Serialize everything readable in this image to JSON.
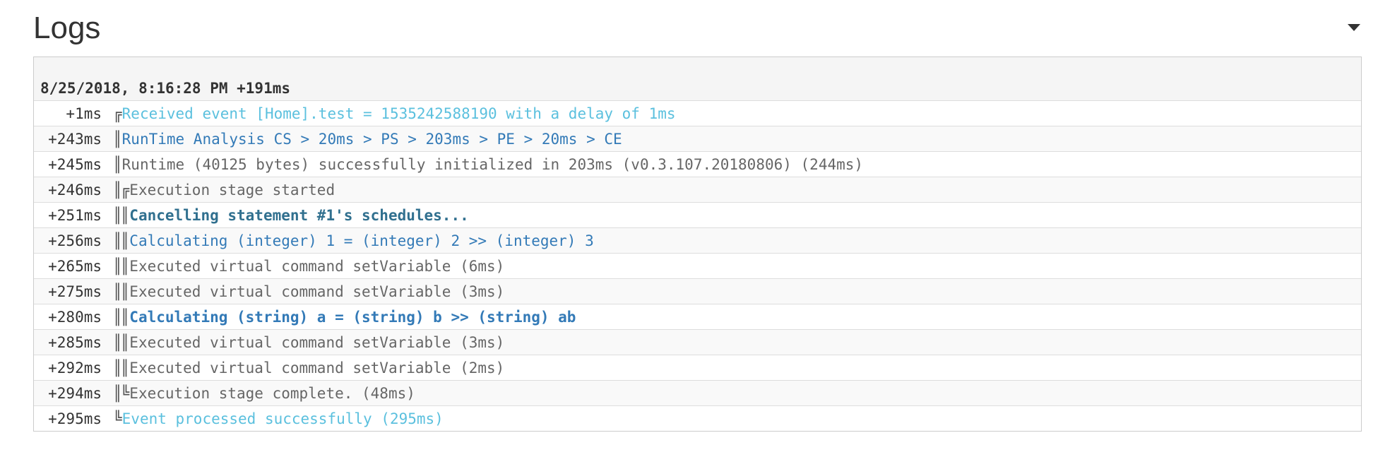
{
  "header": {
    "title": "Logs",
    "toggle_icon": "caret-down-icon"
  },
  "log": {
    "timestamp": "8/25/2018, 8:16:28 PM +191ms",
    "rows": [
      {
        "time": "+1ms",
        "tree": "╔",
        "message": "Received event [Home].test = 1535242588190 with a delay of 1ms",
        "style": "event"
      },
      {
        "time": "+243ms",
        "tree": "║",
        "message": "RunTime Analysis CS > 20ms > PS > 203ms > PE > 20ms > CE",
        "style": "info"
      },
      {
        "time": "+245ms",
        "tree": "║",
        "message": "Runtime (40125 bytes) successfully initialized in 203ms (v0.3.107.20180806) (244ms)",
        "style": "norm"
      },
      {
        "time": "+246ms",
        "tree": "║╔",
        "message": "Execution stage started",
        "style": "norm"
      },
      {
        "time": "+251ms",
        "tree": "║║",
        "message": "Cancelling statement #1's schedules...",
        "style": "bold"
      },
      {
        "time": "+256ms",
        "tree": "║║",
        "message": "Calculating (integer) 1 = (integer) 2 >> (integer) 3",
        "style": "calc"
      },
      {
        "time": "+265ms",
        "tree": "║║",
        "message": "Executed virtual command setVariable (6ms)",
        "style": "norm"
      },
      {
        "time": "+275ms",
        "tree": "║║",
        "message": "Executed virtual command setVariable (3ms)",
        "style": "norm"
      },
      {
        "time": "+280ms",
        "tree": "║║",
        "message": "Calculating (string) a = (string) b >> (string) ab",
        "style": "calcb"
      },
      {
        "time": "+285ms",
        "tree": "║║",
        "message": "Executed virtual command setVariable (3ms)",
        "style": "norm"
      },
      {
        "time": "+292ms",
        "tree": "║║",
        "message": "Executed virtual command setVariable (2ms)",
        "style": "norm"
      },
      {
        "time": "+294ms",
        "tree": "║╚",
        "message": "Execution stage complete. (48ms)",
        "style": "norm"
      },
      {
        "time": "+295ms",
        "tree": "╚",
        "message": "Event processed successfully (295ms)",
        "style": "event"
      }
    ]
  },
  "colors": {
    "event": "#5bc0de",
    "info": "#337ab7",
    "normal": "#666666",
    "bold": "#31708f"
  }
}
